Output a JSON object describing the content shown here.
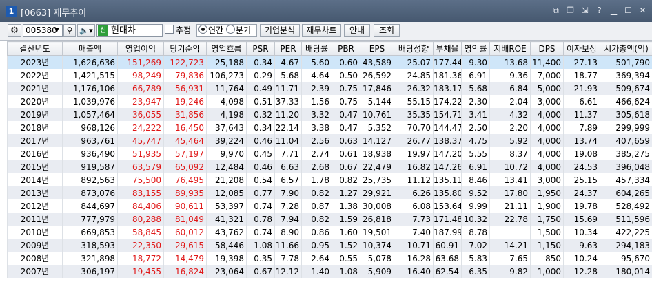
{
  "window": {
    "number": "1",
    "title": "[0663] 재무추이",
    "icons": [
      "window-restore-icon",
      "copy-icon",
      "resize-icon",
      "help-icon",
      "minimize-icon",
      "maximize-icon",
      "close-icon"
    ]
  },
  "toolbar": {
    "gear_icon": "⚙",
    "stock_code": "005380",
    "search_icon": "🔍",
    "speaker_icon": "🔈▾",
    "stock_badge": "신",
    "stock_name": "현대차",
    "estimate_label": "추정",
    "radio_annual": "연간",
    "radio_quarter": "분기",
    "btn_analysis": "기업분석",
    "btn_chart": "재무차트",
    "btn_guide": "안내",
    "btn_query": "조회"
  },
  "table": {
    "headers": [
      "결산년도",
      "매출액",
      "영업이익",
      "당기순익",
      "영업흐름",
      "PSR",
      "PER",
      "배당률",
      "PBR",
      "EPS",
      "배당성향",
      "부채율",
      "영익률",
      "지배ROE",
      "DPS",
      "이자보상",
      "시가총액(억)"
    ],
    "rows": [
      [
        "2023년",
        "1,626,636",
        "151,269",
        "122,723",
        "-25,188",
        "0.34",
        "4.67",
        "5.60",
        "0.60",
        "43,589",
        "25.07",
        "177.44",
        "9.30",
        "13.68",
        "11,400",
        "27.13",
        "501,790"
      ],
      [
        "2022년",
        "1,421,515",
        "98,249",
        "79,836",
        "106,273",
        "0.29",
        "5.68",
        "4.64",
        "0.50",
        "26,592",
        "24.85",
        "181.36",
        "6.91",
        "9.36",
        "7,000",
        "18.77",
        "369,394"
      ],
      [
        "2021년",
        "1,176,106",
        "66,789",
        "56,931",
        "-11,764",
        "0.49",
        "11.71",
        "2.39",
        "0.75",
        "17,846",
        "26.32",
        "183.17",
        "5.68",
        "6.84",
        "5,000",
        "21.93",
        "509,674"
      ],
      [
        "2020년",
        "1,039,976",
        "23,947",
        "19,246",
        "-4,098",
        "0.51",
        "37.33",
        "1.56",
        "0.75",
        "5,144",
        "55.15",
        "174.22",
        "2.30",
        "2.04",
        "3,000",
        "6.61",
        "466,624"
      ],
      [
        "2019년",
        "1,057,464",
        "36,055",
        "31,856",
        "4,198",
        "0.32",
        "11.20",
        "3.32",
        "0.47",
        "10,761",
        "35.35",
        "154.71",
        "3.41",
        "4.32",
        "4,000",
        "11.37",
        "305,618"
      ],
      [
        "2018년",
        "968,126",
        "24,222",
        "16,450",
        "37,643",
        "0.34",
        "22.14",
        "3.38",
        "0.47",
        "5,352",
        "70.70",
        "144.47",
        "2.50",
        "2.20",
        "4,000",
        "7.89",
        "299,999"
      ],
      [
        "2017년",
        "963,761",
        "45,747",
        "45,464",
        "39,224",
        "0.46",
        "11.04",
        "2.56",
        "0.63",
        "14,127",
        "26.77",
        "138.37",
        "4.75",
        "5.92",
        "4,000",
        "13.74",
        "407,659"
      ],
      [
        "2016년",
        "936,490",
        "51,935",
        "57,197",
        "9,970",
        "0.45",
        "7.71",
        "2.74",
        "0.61",
        "18,938",
        "19.97",
        "147.20",
        "5.55",
        "8.37",
        "4,000",
        "19.08",
        "385,275"
      ],
      [
        "2015년",
        "919,587",
        "63,579",
        "65,092",
        "12,484",
        "0.46",
        "6.63",
        "2.68",
        "0.67",
        "22,479",
        "16.82",
        "147.26",
        "6.91",
        "10.72",
        "4,000",
        "24.53",
        "396,048"
      ],
      [
        "2014년",
        "892,563",
        "75,500",
        "76,495",
        "21,208",
        "0.54",
        "6.57",
        "1.78",
        "0.82",
        "25,735",
        "11.12",
        "135.11",
        "8.46",
        "13.41",
        "3,000",
        "25.15",
        "457,334"
      ],
      [
        "2013년",
        "873,076",
        "83,155",
        "89,935",
        "12,085",
        "0.77",
        "7.90",
        "0.82",
        "1.27",
        "29,921",
        "6.26",
        "135.80",
        "9.52",
        "17.80",
        "1,950",
        "24.37",
        "604,265"
      ],
      [
        "2012년",
        "844,697",
        "84,406",
        "90,611",
        "53,397",
        "0.74",
        "7.28",
        "0.87",
        "1.38",
        "30,008",
        "6.08",
        "153.64",
        "9.99",
        "21.11",
        "1,900",
        "19.78",
        "528,492"
      ],
      [
        "2011년",
        "777,979",
        "80,288",
        "81,049",
        "41,321",
        "0.78",
        "7.94",
        "0.82",
        "1.59",
        "26,818",
        "7.73",
        "171.48",
        "10.32",
        "22.78",
        "1,750",
        "15.69",
        "511,596"
      ],
      [
        "2010년",
        "669,853",
        "58,845",
        "60,012",
        "43,762",
        "0.74",
        "8.90",
        "0.86",
        "1.60",
        "19,501",
        "7.40",
        "187.99",
        "8.78",
        "",
        "1,500",
        "10.34",
        "422,225"
      ],
      [
        "2009년",
        "318,593",
        "22,350",
        "29,615",
        "58,446",
        "1.08",
        "11.66",
        "0.95",
        "1.52",
        "10,374",
        "10.71",
        "60.91",
        "7.02",
        "14.21",
        "1,150",
        "9.63",
        "294,183"
      ],
      [
        "2008년",
        "321,898",
        "18,772",
        "14,479",
        "19,398",
        "0.35",
        "7.78",
        "2.64",
        "0.55",
        "5,078",
        "16.28",
        "63.68",
        "5.83",
        "7.65",
        "850",
        "10.24",
        "95,670"
      ],
      [
        "2007년",
        "306,197",
        "19,455",
        "16,824",
        "23,064",
        "0.67",
        "12.12",
        "1.40",
        "1.08",
        "5,909",
        "16.40",
        "62.54",
        "6.35",
        "9.82",
        "1,000",
        "12.28",
        "180,014"
      ]
    ]
  },
  "colors": {
    "profit_text": "#e01818",
    "selected_row": "#cfe6f9",
    "stripe_row": "#e9ecf2"
  }
}
